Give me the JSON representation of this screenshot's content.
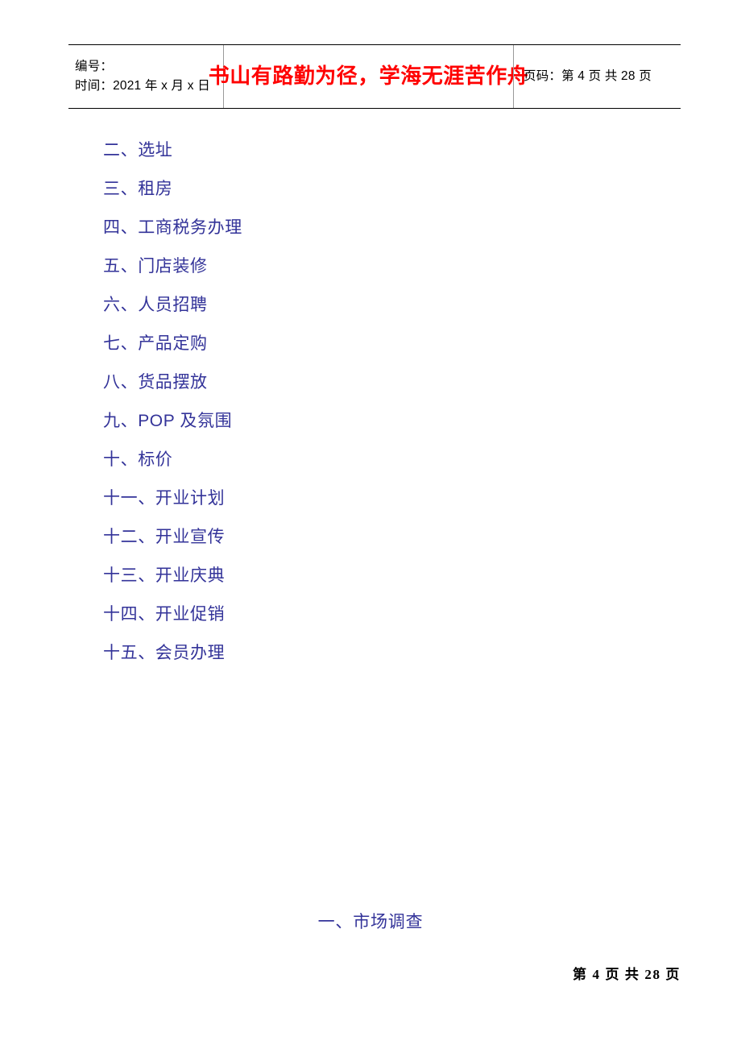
{
  "header": {
    "left_cell": {
      "number_label": "编号：",
      "time_label": "时间：2021 年 x 月 x 日"
    },
    "center_cell": {
      "motto": "书山有路勤为径，学海无涯苦作舟",
      "motto_color": "#ff0000"
    },
    "right_cell": {
      "page_info": "页码：第 4 页 共 28 页"
    }
  },
  "body": {
    "list_color": "#333399",
    "toc_items": [
      {
        "label": "二、选址"
      },
      {
        "label": "三、租房"
      },
      {
        "label": "四、工商税务办理"
      },
      {
        "label": "五、门店装修"
      },
      {
        "label": "六、人员招聘"
      },
      {
        "label": "七、产品定购"
      },
      {
        "label": "八、货品摆放"
      },
      {
        "label": "九、POP 及氛围"
      },
      {
        "label": "十、标价"
      },
      {
        "label": "十一、开业计划"
      },
      {
        "label": "十二、开业宣传"
      },
      {
        "label": "十三、开业庆典"
      },
      {
        "label": "十四、开业促销"
      },
      {
        "label": "十五、会员办理"
      }
    ],
    "section_heading": "一、市场调查"
  },
  "footer": {
    "page_number": "第 4 页 共 28 页"
  }
}
